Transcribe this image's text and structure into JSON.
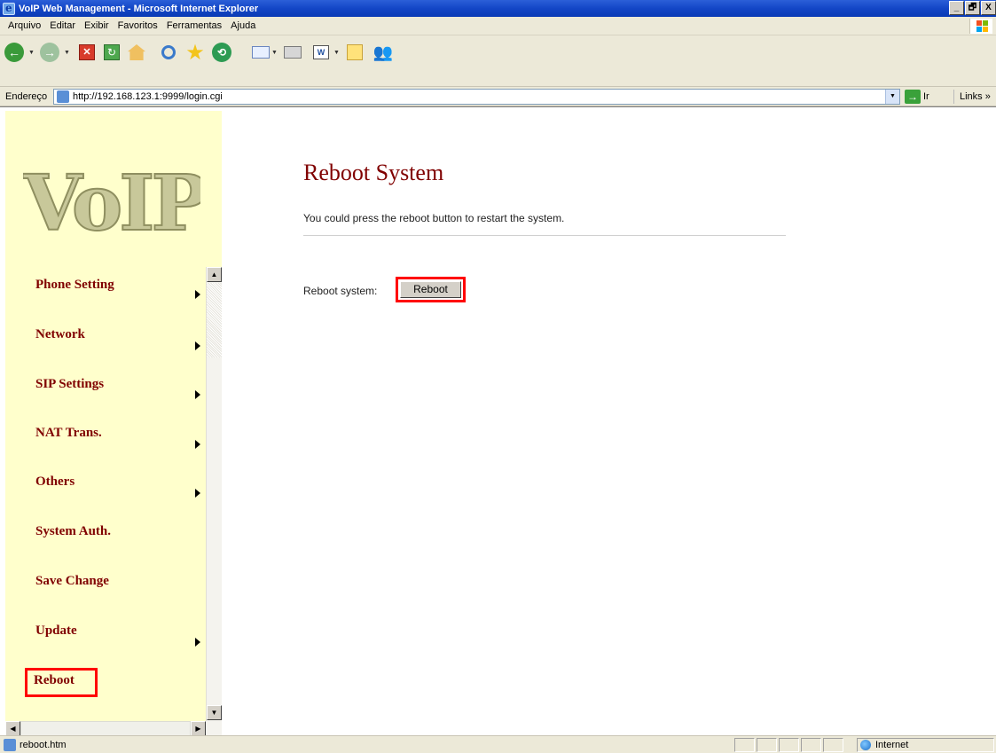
{
  "window": {
    "title": "VoIP Web Management - Microsoft Internet Explorer",
    "controls": [
      "_",
      "🗗",
      "X"
    ]
  },
  "menu": [
    "Arquivo",
    "Editar",
    "Exibir",
    "Favoritos",
    "Ferramentas",
    "Ajuda"
  ],
  "address": {
    "label": "Endereço",
    "url": "http://192.168.123.1:9999/login.cgi",
    "go_label": "Ir",
    "links_label": "Links »"
  },
  "logo_text": "VoIP",
  "nav": {
    "items": [
      {
        "label": "Phone Setting",
        "has_submenu": true
      },
      {
        "label": "Network",
        "has_submenu": true
      },
      {
        "label": "SIP Settings",
        "has_submenu": true
      },
      {
        "label": "NAT Trans.",
        "has_submenu": true
      },
      {
        "label": "Others",
        "has_submenu": true
      },
      {
        "label": "System Auth.",
        "has_submenu": false
      },
      {
        "label": "Save Change",
        "has_submenu": false
      },
      {
        "label": "Update",
        "has_submenu": true
      },
      {
        "label": "Reboot",
        "has_submenu": false,
        "highlighted": true
      }
    ]
  },
  "main": {
    "title": "Reboot System",
    "description": "You could press the reboot button to restart the system.",
    "reboot_label": "Reboot system:",
    "reboot_button": "Reboot"
  },
  "status": {
    "text": "reboot.htm",
    "zone": "Internet"
  },
  "colors": {
    "nav_text": "#800000",
    "nav_bg": "#ffffcc",
    "highlight_border": "#ff0000",
    "title_text": "#800000"
  }
}
